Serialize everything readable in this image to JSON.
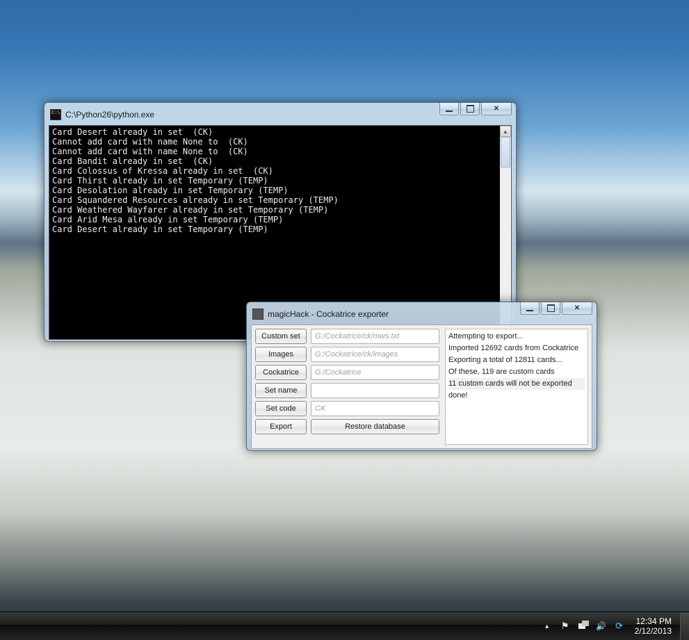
{
  "console": {
    "title": "C:\\Python26\\python.exe",
    "lines": [
      "Card Desert already in set  (CK)",
      "Cannot add card with name None to  (CK)",
      "Cannot add card with name None to  (CK)",
      "Card Bandit already in set  (CK)",
      "Card Colossus of Kressa already in set  (CK)",
      "Card Thirst already in set Temporary (TEMP)",
      "Card Desolation already in set Temporary (TEMP)",
      "Card Squandered Resources already in set Temporary (TEMP)",
      "Card Weathered Wayfarer already in set Temporary (TEMP)",
      "Card Arid Mesa already in set Temporary (TEMP)",
      "Card Desert already in set Temporary (TEMP)"
    ]
  },
  "dialog": {
    "title": "magicHack - Cockatrice exporter",
    "buttons": {
      "custom_set": "Custom set",
      "images": "Images",
      "cockatrice": "Cockatrice",
      "set_name": "Set name",
      "set_code": "Set code",
      "export": "Export",
      "restore_db": "Restore database"
    },
    "fields": {
      "custom_set_path": "G:/Cockatrice/ck/mws.txt",
      "images_path": "G:/Cockatrice/ck/images",
      "cockatrice_path": "G:/Cockatrice",
      "set_name_value": "",
      "set_code_value": "CK"
    },
    "log": [
      "Attempting to export...",
      "Imported 12692 cards from Cockatrice",
      "Exporting a total of 12811 cards...",
      "Of these, 119 are custom cards",
      "11 custom cards will not be exported",
      "done!"
    ],
    "log_highlight_index": 4
  },
  "taskbar": {
    "time": "12:34 PM",
    "date": "2/12/2013"
  }
}
